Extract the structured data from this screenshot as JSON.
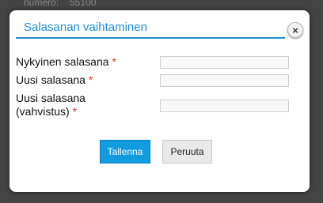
{
  "background": {
    "visible_fragments": [
      "numero:",
      "55100"
    ]
  },
  "dialog": {
    "title": "Salasanan vaihtaminen",
    "close_symbol": "×",
    "accent_color": "#1e8fd8",
    "required_color": "#e0312a",
    "fields": [
      {
        "label": "Nykyinen salasana",
        "required_mark": "*",
        "value": ""
      },
      {
        "label": "Uusi salasana",
        "required_mark": "*",
        "value": ""
      },
      {
        "label_line1": "Uusi salasana",
        "label_line2": "(vahvistus)",
        "required_mark": "*",
        "value": ""
      }
    ],
    "save_label": "Tallenna",
    "cancel_label": "Peruuta"
  }
}
